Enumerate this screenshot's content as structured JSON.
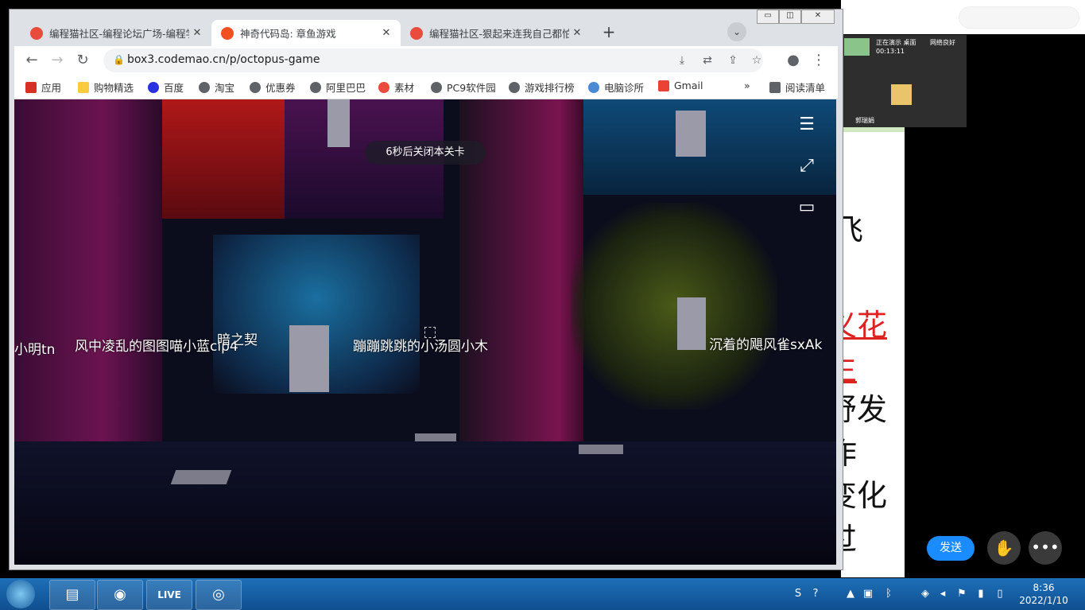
{
  "browser": {
    "tabs": [
      {
        "title": "编程猫社区-编程论坛广场-编程学",
        "close": "✕",
        "favicon_color": "#e94b3c"
      },
      {
        "title": "神奇代码岛: 章鱼游戏",
        "close": "✕",
        "favicon_color": "#f25022"
      },
      {
        "title": "编程猫社区-狠起来连我自己都怕",
        "close": "✕",
        "favicon_color": "#e94b3c"
      }
    ],
    "new_tab": "+",
    "tab_search": "⌄",
    "window_controls": {
      "minimize": "▭",
      "maximize": "◫",
      "close": "✕"
    },
    "nav": {
      "back": "←",
      "forward": "→",
      "reload": "↻"
    },
    "url": "box3.codemao.cn/p/octopus-game",
    "lock": "🔒",
    "omnibox_icons": [
      "install-icon",
      "translate-icon",
      "share-icon",
      "star-icon"
    ],
    "bookmarks": [
      {
        "label": "应用",
        "icon": "apps-icon"
      },
      {
        "label": "购物精选",
        "icon": "folder-icon"
      },
      {
        "label": "百度",
        "icon": "baidu-icon"
      },
      {
        "label": "淘宝",
        "icon": "globe-icon"
      },
      {
        "label": "优惠券",
        "icon": "globe-icon"
      },
      {
        "label": "阿里巴巴",
        "icon": "globe-icon"
      },
      {
        "label": "素材",
        "icon": "codemao-icon"
      },
      {
        "label": "PC9软件园",
        "icon": "globe-icon"
      },
      {
        "label": "游戏排行榜",
        "icon": "globe-icon"
      },
      {
        "label": "电脑诊所",
        "icon": "clinic-icon"
      },
      {
        "label": "Gmail",
        "icon": "gmail-icon"
      }
    ],
    "bookmarks_overflow": "»",
    "reading_list": "阅读清单"
  },
  "game": {
    "toast": "6秒后关闭本关卡",
    "player_names": [
      "小明tn",
      "风中凌乱的图图喵小蓝clp4",
      "暗之契",
      "蹦蹦跳跳的小汤圆小木",
      "沉着的飓风雀sxAk"
    ]
  },
  "meeting": {
    "status": "正在演示 桌面",
    "timer": "00:13:11",
    "network": "网络良好",
    "presenter": "郭瑞娟",
    "send": "发送",
    "raise_hand": "✋",
    "more": "•••"
  },
  "doc_glyphs": [
    "飞",
    "义花生",
    "舒发作",
    "变化过"
  ],
  "taskbar": {
    "live": "LIVE",
    "time": "8:36",
    "date": "2022/1/10"
  }
}
